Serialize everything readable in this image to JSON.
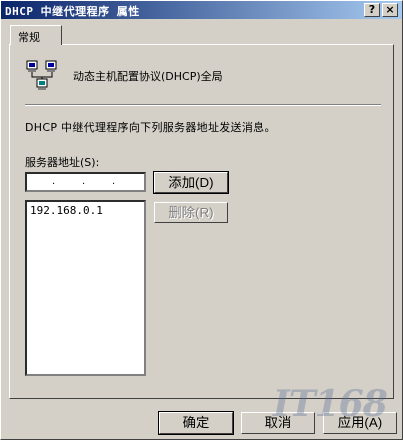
{
  "window": {
    "title": "DHCP 中继代理程序 属性",
    "help_glyph": "?",
    "close_glyph": "×"
  },
  "tabs": [
    {
      "label": "常规",
      "active": true
    }
  ],
  "header": {
    "icon": "network-computers-icon",
    "text": "动态主机配置协议(DHCP)全局"
  },
  "description": "DHCP 中继代理程序向下列服务器地址发送消息。",
  "server_address": {
    "label": "服务器地址(S):",
    "input_value": ". . .",
    "list": [
      "192.168.0.1"
    ]
  },
  "buttons": {
    "add": "添加(D)",
    "remove": "删除(R)",
    "ok": "确定",
    "cancel": "取消",
    "apply": "应用(A)"
  },
  "watermark": "IT168",
  "colors": {
    "title_start": "#0a246a",
    "title_end": "#a6caf0",
    "face": "#d4d0c8"
  }
}
